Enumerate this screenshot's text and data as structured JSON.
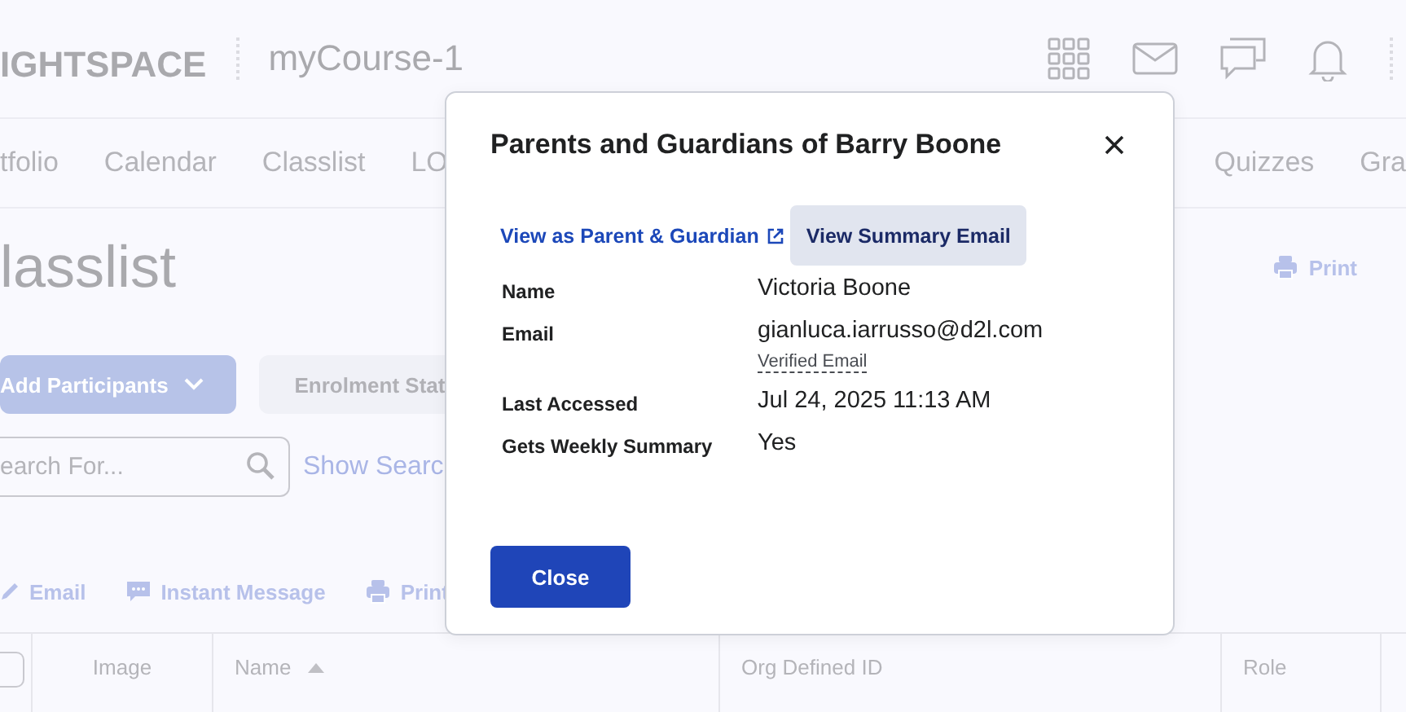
{
  "header": {
    "logo": "IGHTSPACE",
    "course_title": "myCourse-1"
  },
  "nav": {
    "left": [
      "tfolio",
      "Calendar",
      "Classlist",
      "LO"
    ],
    "right": [
      "Quizzes",
      "Gra"
    ]
  },
  "page": {
    "title": "lasslist",
    "print_link": "Print"
  },
  "buttons": [
    {
      "label": "Add Participants",
      "kind": "primary"
    },
    {
      "label": "Enrolment Stat",
      "kind": "secondary"
    }
  ],
  "search": {
    "placeholder": "earch For...",
    "show_search": "Show Searc"
  },
  "actions": [
    {
      "label": "Email",
      "kind": "email"
    },
    {
      "label": "Instant Message",
      "kind": "message"
    },
    {
      "label": "Print",
      "kind": "print"
    }
  ],
  "table": {
    "columns": [
      {
        "kind": "checkbox",
        "checked": false
      },
      {
        "label": "Image",
        "kind": "text"
      },
      {
        "label": "Name",
        "kind": "text",
        "sorted_ascending": true
      },
      {
        "label": "Org Defined ID",
        "kind": "text"
      },
      {
        "label": "Role",
        "kind": "text"
      }
    ]
  },
  "dialog": {
    "title": "Parents and Guardians of Barry Boone",
    "links": [
      {
        "label": "View as Parent & Guardian",
        "kind": "external"
      },
      {
        "label": "View Summary Email",
        "kind": "button"
      }
    ],
    "fields": [
      {
        "label": "Name",
        "value": "Victoria Boone"
      },
      {
        "label": "Email",
        "value": "gianluca.iarrusso@d2l.com",
        "note": "Verified Email"
      },
      {
        "label": "Last Accessed",
        "value": "Jul 24, 2025 11:13 AM"
      },
      {
        "label": "Gets Weekly Summary",
        "value": "Yes"
      }
    ],
    "close_button": "Close"
  }
}
